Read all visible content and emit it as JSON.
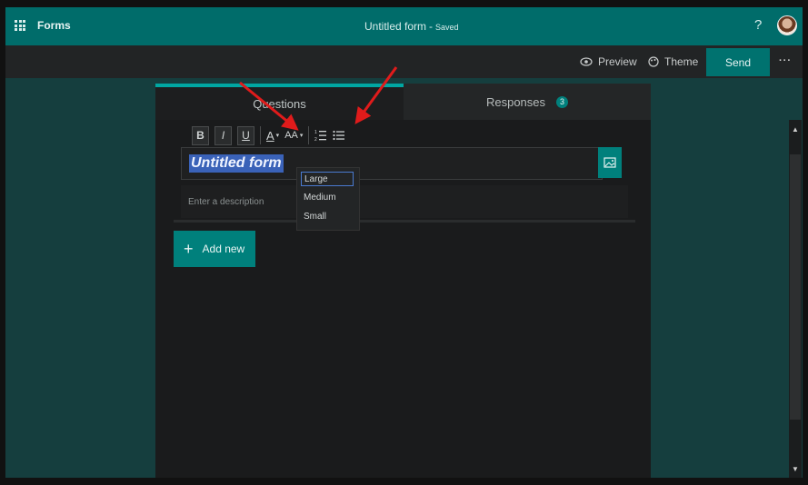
{
  "app": {
    "name": "Forms",
    "icons": {
      "launcher": "waffle-icon"
    }
  },
  "header": {
    "title": "Untitled form",
    "separator": "-",
    "status": "Saved",
    "help": "?"
  },
  "commandbar": {
    "preview": "Preview",
    "theme": "Theme",
    "send": "Send",
    "more": "···"
  },
  "tabs": {
    "questions": "Questions",
    "responses": "Responses",
    "responses_count": "3"
  },
  "toolbar": {
    "bold": "B",
    "italic": "I",
    "underline": "U",
    "font_color": "A",
    "font_size": "AA"
  },
  "form": {
    "title": "Untitled form",
    "description_placeholder": "Enter a description"
  },
  "font_size_menu": {
    "items": [
      "Large",
      "Medium",
      "Small"
    ],
    "selected": "Large"
  },
  "add_new": {
    "label": "Add new"
  },
  "colors": {
    "brand": "#006c6a",
    "accent": "#00807c",
    "selection": "#3a62b8"
  }
}
